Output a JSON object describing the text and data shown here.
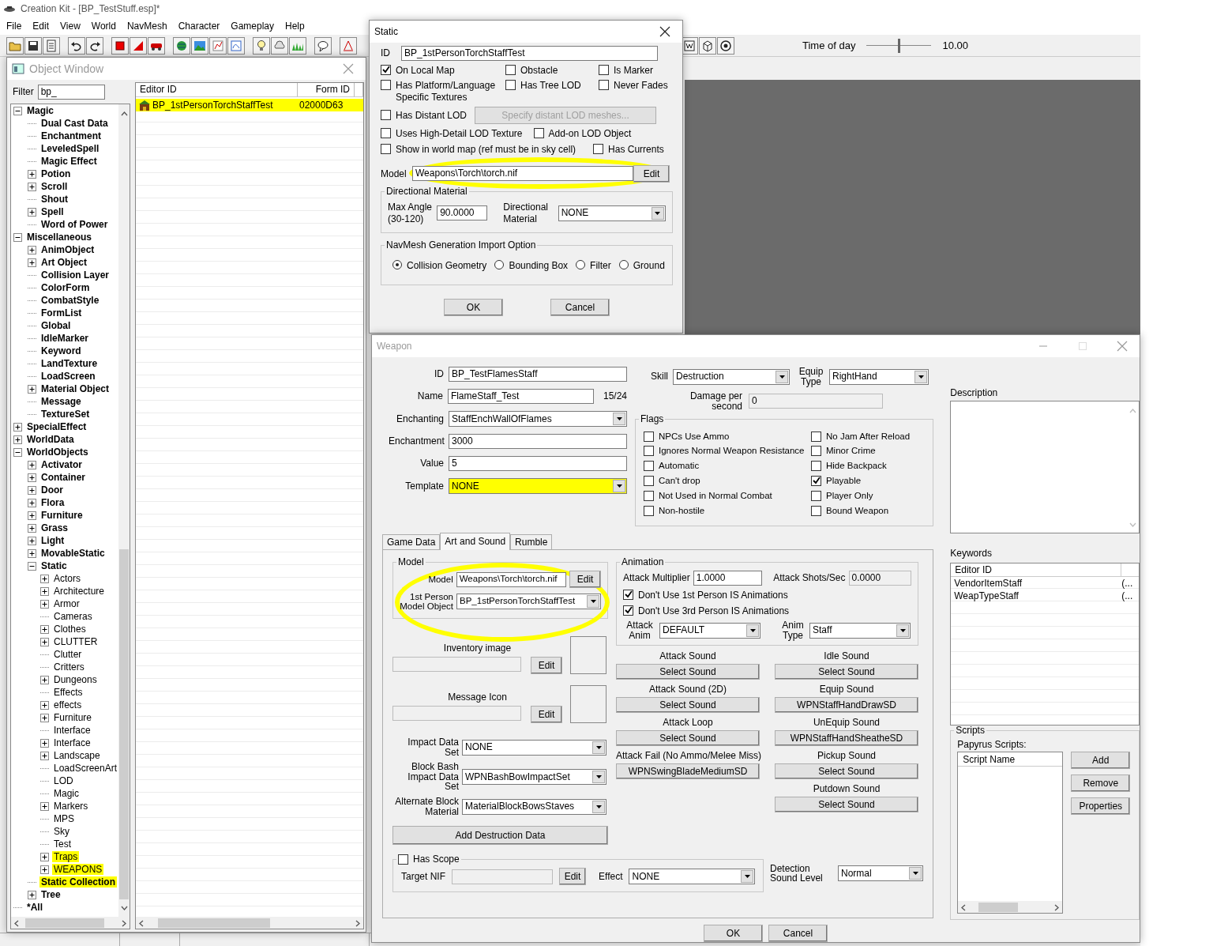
{
  "app": {
    "title": "Creation Kit - [BP_TestStuff.esp]*",
    "menu": [
      "File",
      "Edit",
      "View",
      "World",
      "NavMesh",
      "Character",
      "Gameplay",
      "Help"
    ],
    "time_of_day": {
      "label": "Time of day",
      "level": 0.49,
      "value": "10.00"
    }
  },
  "object_window": {
    "title": "Object Window",
    "filter_label": "Filter",
    "filter": "bp_",
    "tree": [
      {
        "label": "Magic",
        "expanded": true,
        "children": [
          {
            "label": "Dual Cast Data"
          },
          {
            "label": "Enchantment"
          },
          {
            "label": "LeveledSpell"
          },
          {
            "label": "Magic Effect"
          },
          {
            "label": "Potion",
            "expanded": false
          },
          {
            "label": "Scroll",
            "expanded": false
          },
          {
            "label": "Shout"
          },
          {
            "label": "Spell",
            "expanded": false
          },
          {
            "label": "Word of Power"
          }
        ]
      },
      {
        "label": "Miscellaneous",
        "expanded": true,
        "children": [
          {
            "label": "AnimObject",
            "expanded": false
          },
          {
            "label": "Art Object",
            "expanded": false
          },
          {
            "label": "Collision Layer"
          },
          {
            "label": "ColorForm"
          },
          {
            "label": "CombatStyle"
          },
          {
            "label": "FormList"
          },
          {
            "label": "Global"
          },
          {
            "label": "IdleMarker"
          },
          {
            "label": "Keyword"
          },
          {
            "label": "LandTexture"
          },
          {
            "label": "LoadScreen"
          },
          {
            "label": "Material Object",
            "expanded": false
          },
          {
            "label": "Message"
          },
          {
            "label": "TextureSet"
          }
        ]
      },
      {
        "label": "SpecialEffect",
        "expanded": false
      },
      {
        "label": "WorldData",
        "expanded": false
      },
      {
        "label": "WorldObjects",
        "expanded": true,
        "children": [
          {
            "label": "Activator",
            "expanded": false
          },
          {
            "label": "Container",
            "expanded": false
          },
          {
            "label": "Door",
            "expanded": false
          },
          {
            "label": "Flora",
            "expanded": false
          },
          {
            "label": "Furniture",
            "expanded": false
          },
          {
            "label": "Grass",
            "expanded": false
          },
          {
            "label": "Light",
            "expanded": false
          },
          {
            "label": "MovableStatic",
            "expanded": false
          },
          {
            "label": "Static",
            "expanded": true,
            "children": [
              {
                "label": "Actors",
                "expanded": false
              },
              {
                "label": "Architecture",
                "expanded": false
              },
              {
                "label": "Armor",
                "expanded": false
              },
              {
                "label": "Cameras"
              },
              {
                "label": "Clothes",
                "expanded": false
              },
              {
                "label": "CLUTTER",
                "expanded": false
              },
              {
                "label": "Clutter"
              },
              {
                "label": "Critters"
              },
              {
                "label": "Dungeons",
                "expanded": false
              },
              {
                "label": "Effects"
              },
              {
                "label": "effects",
                "expanded": false
              },
              {
                "label": "Furniture",
                "expanded": false
              },
              {
                "label": "Interface"
              },
              {
                "label": "Interface",
                "expanded": false
              },
              {
                "label": "Landscape",
                "expanded": false
              },
              {
                "label": "LoadScreenArt"
              },
              {
                "label": "LOD"
              },
              {
                "label": "Magic"
              },
              {
                "label": "Markers",
                "expanded": false
              },
              {
                "label": "MPS"
              },
              {
                "label": "Sky"
              },
              {
                "label": "Test"
              },
              {
                "label": "Traps",
                "expanded": false,
                "highlighted": true
              },
              {
                "label": "WEAPONS",
                "expanded": false,
                "highlighted": true
              }
            ]
          },
          {
            "label": "Static Collection",
            "highlighted": true
          },
          {
            "label": "Tree",
            "expanded": false
          }
        ]
      },
      {
        "label": "*All"
      }
    ],
    "columns": [
      "Editor ID",
      "Form ID"
    ],
    "rows": [
      {
        "editor_id": "BP_1stPersonTorchStaffTest",
        "form_id": "02000D63",
        "highlighted": true
      }
    ]
  },
  "static_dialog": {
    "title": "Static",
    "id_label": "ID",
    "id": "BP_1stPersonTorchStaffTest",
    "flag_rows": [
      [
        {
          "kind": "checkbox",
          "label": "On Local Map",
          "checked": true
        },
        {
          "kind": "checkbox",
          "label": "Obstacle",
          "checked": false
        },
        {
          "kind": "checkbox",
          "label": "Is Marker",
          "checked": false
        }
      ],
      [
        {
          "kind": "checkbox",
          "label": "Has Platform/Language Specific Textures",
          "checked": false
        },
        {
          "kind": "checkbox",
          "label": "Has Tree LOD",
          "checked": false
        },
        {
          "kind": "checkbox",
          "label": "Never Fades",
          "checked": false
        }
      ],
      [
        {
          "kind": "checkbox",
          "label": "Has Distant LOD",
          "checked": false
        },
        {
          "kind": "button",
          "label": "Specify distant LOD meshes...",
          "disabled": true
        }
      ],
      [
        {
          "kind": "checkbox",
          "label": "Uses High-Detail LOD Texture",
          "checked": false
        },
        {
          "kind": "checkbox",
          "label": "Add-on LOD Object",
          "checked": false
        }
      ],
      [
        {
          "kind": "checkbox",
          "label": "Show in world map (ref must be in sky cell)",
          "checked": false
        },
        {
          "kind": "checkbox",
          "label": "Has Currents",
          "checked": false
        }
      ]
    ],
    "model": {
      "label": "Model",
      "value": "Weapons\\Torch\\torch.nif",
      "button": "Edit",
      "highlighted": true
    },
    "directional": {
      "title": "Directional Material",
      "angle_label": "Max Angle (30-120)",
      "angle": "90.0000",
      "material_label": "Directional Material",
      "material": "NONE"
    },
    "navmesh": {
      "title": "NavMesh Generation Import Option",
      "options": [
        {
          "label": "Collision Geometry",
          "selected": true
        },
        {
          "label": "Bounding Box",
          "selected": false
        },
        {
          "label": "Filter",
          "selected": false
        },
        {
          "label": "Ground",
          "selected": false
        }
      ]
    },
    "buttons": [
      "OK",
      "Cancel"
    ]
  },
  "weapon_dialog": {
    "title": "Weapon",
    "fields": [
      {
        "kind": "text",
        "label": "ID",
        "value": "BP_TestFlamesStaff"
      },
      {
        "kind": "text",
        "label": "Name",
        "value": "FlameStaff_Test",
        "counter": "15/24"
      },
      {
        "kind": "combo",
        "label": "Enchanting",
        "value": "StaffEnchWallOfFlames"
      },
      {
        "kind": "text",
        "label": "Enchantment",
        "value": "3000"
      },
      {
        "kind": "text",
        "label": "Value",
        "value": "5"
      },
      {
        "kind": "combo",
        "label": "Template",
        "value": "NONE",
        "highlighted": true
      }
    ],
    "skill": {
      "label": "Skill",
      "value": "Destruction"
    },
    "equip_type": {
      "label": "Equip Type",
      "value": "RightHand"
    },
    "damage_per_second": {
      "label": "Damage per second",
      "value": "0"
    },
    "flags": {
      "title": "Flags",
      "items": [
        {
          "label": "NPCs Use Ammo",
          "checked": false
        },
        {
          "label": "No Jam After Reload",
          "checked": false
        },
        {
          "label": "Ignores Normal Weapon Resistance",
          "checked": false
        },
        {
          "label": "Minor Crime",
          "checked": false
        },
        {
          "label": "Automatic",
          "checked": false
        },
        {
          "label": "Hide Backpack",
          "checked": false
        },
        {
          "label": "Can't drop",
          "checked": false
        },
        {
          "label": "Playable",
          "checked": true
        },
        {
          "label": "Not Used in Normal Combat",
          "checked": false
        },
        {
          "label": "Player Only",
          "checked": false
        },
        {
          "label": "Non-hostile",
          "checked": false
        },
        {
          "label": "Bound Weapon",
          "checked": false
        }
      ]
    },
    "description_label": "Description",
    "keywords": {
      "label": "Keywords",
      "columns": [
        "Editor ID"
      ],
      "rows": [
        {
          "editor_id": "VendorItemStaff",
          "column_2": "(..."
        },
        {
          "editor_id": "WeapTypeStaff",
          "column_2": "(..."
        }
      ]
    },
    "scripts": {
      "title": "Scripts",
      "label": "Papyrus Scripts:",
      "column": "Script Name",
      "buttons": [
        "Add",
        "Remove",
        "Properties"
      ]
    },
    "tabs": [
      {
        "label": "Game Data",
        "selected": false
      },
      {
        "label": "Art and Sound",
        "selected": true
      },
      {
        "label": "Rumble",
        "selected": false
      }
    ],
    "model": {
      "title": "Model",
      "highlighted": true,
      "model_label": "Model",
      "model": "Weapons\\Torch\\torch.nif",
      "edit": "Edit",
      "first_person_label": "1st Person Model Object",
      "first_person": "BP_1stPersonTorchStaffTest"
    },
    "images": [
      {
        "label": "Inventory image",
        "button": "Edit"
      },
      {
        "label": "Message Icon",
        "button": "Edit"
      }
    ],
    "data_sets": [
      {
        "label": "Impact Data Set",
        "value": "NONE"
      },
      {
        "label": "Block Bash Impact Data Set",
        "value": "WPNBashBowImpactSet"
      },
      {
        "label": "Alternate Block Material",
        "value": "MaterialBlockBowsStaves"
      }
    ],
    "destruction_button": "Add Destruction Data",
    "scope": {
      "label": "Has Scope",
      "checked": false,
      "target_label": "Target NIF",
      "edit": "Edit",
      "effect_label": "Effect",
      "effect": "NONE"
    },
    "animation": {
      "title": "Animation",
      "multiplier_label": "Attack Multiplier",
      "multiplier": "1.0000",
      "shots_label": "Attack Shots/Sec",
      "shots": "0.0000",
      "options": [
        {
          "label": "Don't Use 1st Person IS Animations",
          "checked": true
        },
        {
          "label": "Don't Use 3rd Person IS Animations",
          "checked": true
        }
      ],
      "attack_anim_label": "Attack Anim",
      "attack_anim": "DEFAULT",
      "anim_type_label": "Anim Type",
      "anim_type": "Staff"
    },
    "sounds_left": [
      {
        "label": "Attack Sound",
        "value": "Select Sound"
      },
      {
        "label": "Attack Sound  (2D)",
        "value": "Select Sound"
      },
      {
        "label": "Attack Loop",
        "value": "Select Sound"
      },
      {
        "label": "Attack Fail (No Ammo/Melee Miss)",
        "value": "WPNSwingBladeMediumSD"
      }
    ],
    "sounds_right": [
      {
        "label": "Idle Sound",
        "value": "Select Sound"
      },
      {
        "label": "Equip Sound",
        "value": "WPNStaffHandDrawSD"
      },
      {
        "label": "UnEquip Sound",
        "value": "WPNStaffHandSheatheSD"
      },
      {
        "label": "Pickup Sound",
        "value": "Select Sound"
      },
      {
        "label": "Putdown Sound",
        "value": "Select Sound"
      }
    ],
    "detection": {
      "label": "Detection Sound Level",
      "value": "Normal"
    },
    "buttons": [
      "OK",
      "Cancel"
    ]
  }
}
